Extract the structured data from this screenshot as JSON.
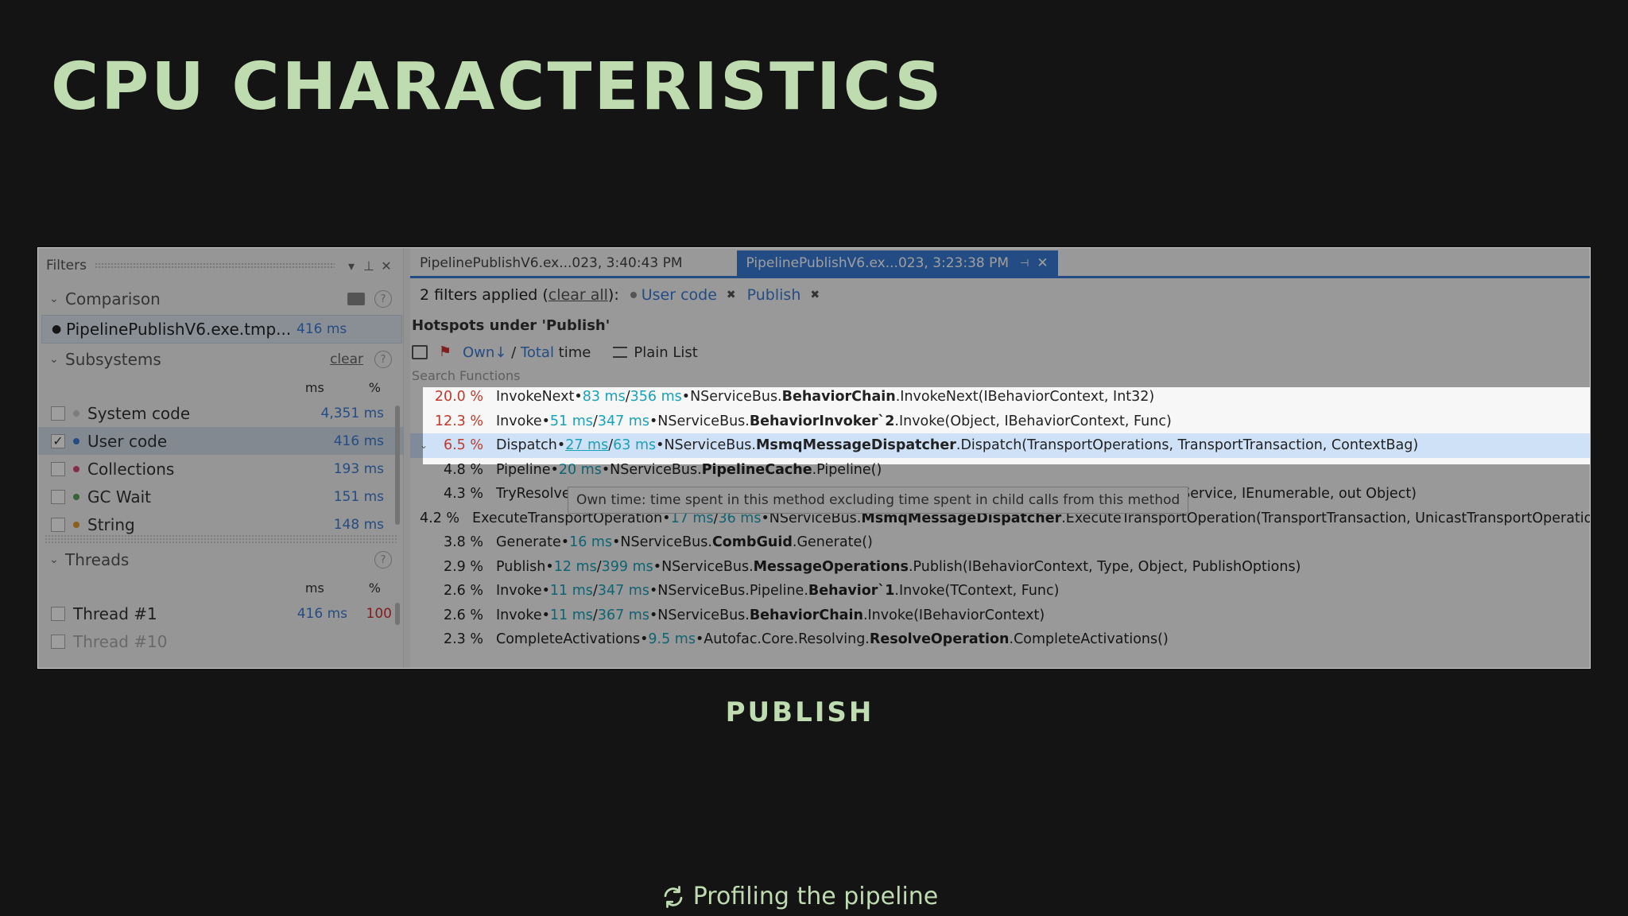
{
  "slide": {
    "title": "CPU CHARACTERISTICS",
    "caption": "PUBLISH",
    "footer": "Profiling the pipeline"
  },
  "filters_panel": {
    "title": "Filters",
    "comparison": {
      "label": "Comparison",
      "item": {
        "name": "PipelinePublishV6.exe.tmp...",
        "ms": "416 ms"
      }
    },
    "subsystems": {
      "label": "Subsystems",
      "clear": "clear",
      "col_ms": "ms",
      "col_pct": "%",
      "items": [
        {
          "label": "System code",
          "ms": "4,351 ms",
          "checked": false,
          "color": "#c8c8c8"
        },
        {
          "label": "User code",
          "ms": "416 ms",
          "checked": true,
          "color": "#3a7bd5"
        },
        {
          "label": "Collections",
          "ms": "193 ms",
          "checked": false,
          "color": "#d54a7a"
        },
        {
          "label": "GC Wait",
          "ms": "151 ms",
          "checked": false,
          "color": "#5aa05a"
        },
        {
          "label": "String",
          "ms": "148 ms",
          "checked": false,
          "color": "#e59a2a"
        }
      ]
    },
    "threads": {
      "label": "Threads",
      "col_ms": "ms",
      "col_pct": "%",
      "items": [
        {
          "label": "Thread #1",
          "ms": "416 ms",
          "pct": "100"
        },
        {
          "label": "Thread #10",
          "ms": "",
          "pct": ""
        }
      ]
    }
  },
  "main": {
    "tabs": [
      {
        "label": "PipelinePublishV6.ex...023, 3:40:43 PM",
        "active": false
      },
      {
        "label": "PipelinePublishV6.ex...023, 3:23:38 PM",
        "active": true
      }
    ],
    "filters_applied": "2 filters applied (",
    "clear_all": "clear all",
    "filters_applied_end": "):",
    "chips": [
      "User code",
      "Publish"
    ],
    "hotspots_title": "Hotspots under 'Publish'",
    "toolbar": {
      "own": "Own↓",
      "slash": " / ",
      "total": "Total",
      "time": " time",
      "plain_list": "Plain List"
    },
    "search_placeholder": "Search Functions",
    "tooltip": "Own time: time spent in this method excluding time spent in child calls from this method",
    "rows": [
      {
        "pct": "20.0 %",
        "name": "InvokeNext",
        "own": "83 ms",
        "total": "356 ms",
        "ns": "NServiceBus.",
        "cls": "BehaviorChain",
        "sig": ".InvokeNext(IBehaviorContext, Int32)"
      },
      {
        "pct": "12.3 %",
        "name": "Invoke",
        "own": "51 ms",
        "total": "347 ms",
        "ns": "NServiceBus.",
        "cls": "BehaviorInvoker`2",
        "sig": ".Invoke(Object, IBehaviorContext, Func)"
      },
      {
        "pct": "6.5 %",
        "name": "Dispatch",
        "own": "27 ms",
        "total": "63 ms",
        "ns": "NServiceBus.",
        "cls": "MsmqMessageDispatcher",
        "sig": ".Dispatch(TransportOperations, TransportTransaction, ContextBag)"
      },
      {
        "pct": "4.8 %",
        "name": "Pipeline",
        "own": "20 ms",
        "total": "",
        "ns": "NServiceBus.",
        "cls": "PipelineCache",
        "sig": ".Pipeline()"
      },
      {
        "pct": "4.3 %",
        "name": "TryResolveSer",
        "own": "",
        "total": "",
        "ns": "",
        "cls": "",
        "sig": "",
        "tail": "; Service, IEnumerable, out Object)"
      },
      {
        "pct": "4.2 %",
        "name": "ExecuteTransportOperation",
        "own": "17 ms",
        "total": "36 ms",
        "ns": "NServiceBus.",
        "cls": "MsmqMessageDispatcher",
        "sig": ".ExecuteTransportOperation(TransportTransaction, UnicastTransportOperation)"
      },
      {
        "pct": "3.8 %",
        "name": "Generate",
        "own": "16 ms",
        "total": "",
        "ns": "NServiceBus.",
        "cls": "CombGuid",
        "sig": ".Generate()"
      },
      {
        "pct": "2.9 %",
        "name": "Publish",
        "own": "12 ms",
        "total": "399 ms",
        "ns": "NServiceBus.",
        "cls": "MessageOperations",
        "sig": ".Publish(IBehaviorContext, Type, Object, PublishOptions)"
      },
      {
        "pct": "2.6 %",
        "name": "Invoke",
        "own": "11 ms",
        "total": "347 ms",
        "ns": "NServiceBus.Pipeline.",
        "cls": "Behavior`1",
        "sig": ".Invoke(TContext, Func)"
      },
      {
        "pct": "2.6 %",
        "name": "Invoke",
        "own": "11 ms",
        "total": "367 ms",
        "ns": "NServiceBus.",
        "cls": "BehaviorChain",
        "sig": ".Invoke(IBehaviorContext)"
      },
      {
        "pct": "2.3 %",
        "name": "CompleteActivations",
        "own": "9.5 ms",
        "total": "",
        "ns": "Autofac.Core.Resolving.",
        "cls": "ResolveOperation",
        "sig": ".CompleteActivations()"
      }
    ]
  }
}
